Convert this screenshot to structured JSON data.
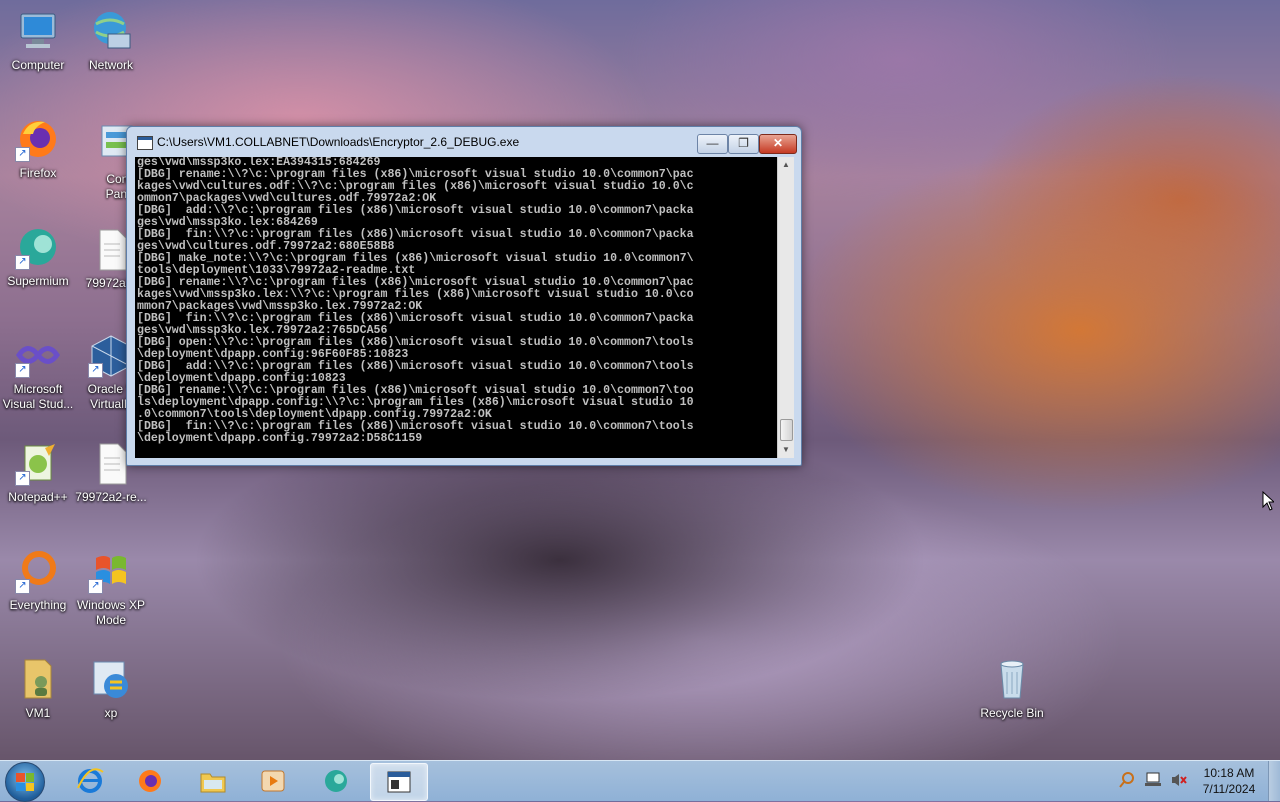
{
  "desktop": {
    "icons": [
      {
        "label": "Computer",
        "icon": "computer-icon"
      },
      {
        "label": "Network",
        "icon": "network-icon"
      },
      {
        "label": "Firefox",
        "icon": "firefox-icon"
      },
      {
        "label": "Contr\nPanel",
        "icon": "control-panel-icon"
      },
      {
        "label": "Supermium",
        "icon": "supermium-icon"
      },
      {
        "label": "79972a2-",
        "icon": "text-file-icon"
      },
      {
        "label": "Microsoft\nVisual Stud...",
        "icon": "visual-studio-icon"
      },
      {
        "label": "Oracle V\nVirtualB",
        "icon": "virtualbox-icon"
      },
      {
        "label": "Notepad++",
        "icon": "notepadpp-icon"
      },
      {
        "label": "79972a2-re...",
        "icon": "text-file-icon"
      },
      {
        "label": "Everything",
        "icon": "everything-icon"
      },
      {
        "label": "Windows XP\nMode",
        "icon": "windows-xp-mode-icon"
      },
      {
        "label": "VM1",
        "icon": "user-folder-icon"
      },
      {
        "label": "xp",
        "icon": "xp-icon"
      },
      {
        "label": "Recycle Bin",
        "icon": "recycle-bin-icon"
      }
    ]
  },
  "console_window": {
    "title": "C:\\Users\\VM1.COLLABNET\\Downloads\\Encryptor_2.6_DEBUG.exe",
    "min_label": "—",
    "max_label": "❐",
    "close_label": "✕",
    "output": "ges\\vwd\\mssp3ko.lex:EA394315:684269\n[DBG] rename:\\\\?\\c:\\program files (x86)\\microsoft visual studio 10.0\\common7\\pac\nkages\\vwd\\cultures.odf:\\\\?\\c:\\program files (x86)\\microsoft visual studio 10.0\\c\nommon7\\packages\\vwd\\cultures.odf.79972a2:OK\n[DBG]  add:\\\\?\\c:\\program files (x86)\\microsoft visual studio 10.0\\common7\\packa\nges\\vwd\\mssp3ko.lex:684269\n[DBG]  fin:\\\\?\\c:\\program files (x86)\\microsoft visual studio 10.0\\common7\\packa\nges\\vwd\\cultures.odf.79972a2:680E58B8\n[DBG] make_note:\\\\?\\c:\\program files (x86)\\microsoft visual studio 10.0\\common7\\\ntools\\deployment\\1033\\79972a2-readme.txt\n[DBG] rename:\\\\?\\c:\\program files (x86)\\microsoft visual studio 10.0\\common7\\pac\nkages\\vwd\\mssp3ko.lex:\\\\?\\c:\\program files (x86)\\microsoft visual studio 10.0\\co\nmmon7\\packages\\vwd\\mssp3ko.lex.79972a2:OK\n[DBG]  fin:\\\\?\\c:\\program files (x86)\\microsoft visual studio 10.0\\common7\\packa\nges\\vwd\\mssp3ko.lex.79972a2:765DCA56\n[DBG] open:\\\\?\\c:\\program files (x86)\\microsoft visual studio 10.0\\common7\\tools\n\\deployment\\dpapp.config:96F60F85:10823\n[DBG]  add:\\\\?\\c:\\program files (x86)\\microsoft visual studio 10.0\\common7\\tools\n\\deployment\\dpapp.config:10823\n[DBG] rename:\\\\?\\c:\\program files (x86)\\microsoft visual studio 10.0\\common7\\too\nls\\deployment\\dpapp.config:\\\\?\\c:\\program files (x86)\\microsoft visual studio 10\n.0\\common7\\tools\\deployment\\dpapp.config.79972a2:OK\n[DBG]  fin:\\\\?\\c:\\program files (x86)\\microsoft visual studio 10.0\\common7\\tools\n\\deployment\\dpapp.config.79972a2:D58C1159",
    "scroll_up": "▲",
    "scroll_down": "▼"
  },
  "taskbar": {
    "apps": [
      {
        "icon": "internet-explorer-icon",
        "active": false
      },
      {
        "icon": "firefox-icon",
        "active": false
      },
      {
        "icon": "file-explorer-icon",
        "active": false
      },
      {
        "icon": "media-player-icon",
        "active": false
      },
      {
        "icon": "supermium-icon",
        "active": false
      },
      {
        "icon": "console-icon",
        "active": true
      }
    ],
    "tray_icons": [
      "action-center-icon",
      "network-icon",
      "volume-muted-icon"
    ],
    "clock_time": "10:18 AM",
    "clock_date": "7/11/2024"
  },
  "colors": {
    "console_bg": "#000000",
    "console_text": "#c0c0c0",
    "taskbar": "#9fbbd9"
  }
}
